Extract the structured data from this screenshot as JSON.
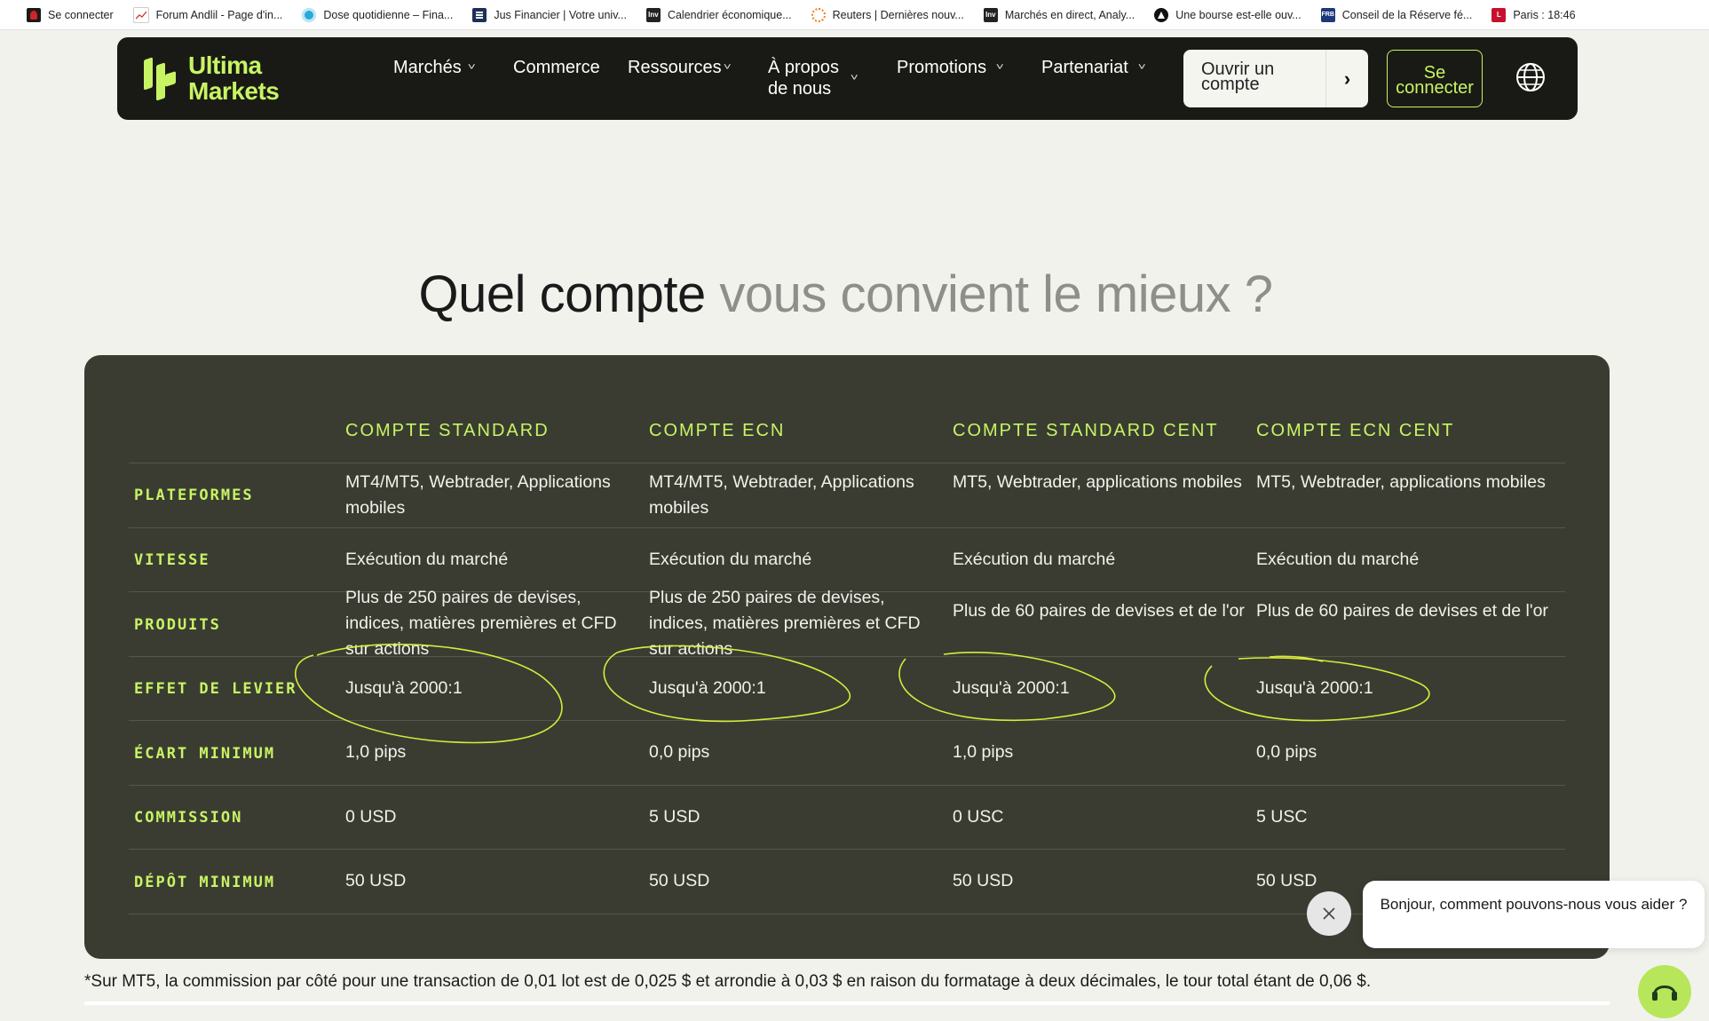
{
  "bookmarks": [
    {
      "icon": "red-logo-icon",
      "label": "Se connecter"
    },
    {
      "icon": "chart-icon",
      "label": "Forum Andlil - Page d'in..."
    },
    {
      "icon": "circle-icon",
      "label": "Dose quotidienne – Fina..."
    },
    {
      "icon": "jus-icon",
      "label": "Jus Financier | Votre univ..."
    },
    {
      "icon": "inv-icon",
      "label": "Calendrier économique..."
    },
    {
      "icon": "reuters-icon",
      "label": "Reuters | Dernières nouv..."
    },
    {
      "icon": "inv-icon",
      "label": "Marchés en direct, Analy..."
    },
    {
      "icon": "triangle-icon",
      "label": "Une bourse est-elle ouv..."
    },
    {
      "icon": "frb-icon",
      "label": "Conseil de la Réserve fé..."
    },
    {
      "icon": "paris-icon",
      "label": "Paris : 18:46"
    }
  ],
  "bookmark_badges": {
    "inv": "Inv",
    "frb": "FRB",
    "paris": "L"
  },
  "header": {
    "logo_line1": "Ultima",
    "logo_line2": "Markets",
    "nav": {
      "marches": "Marchés",
      "commerce": "Commerce",
      "ressources": "Ressources",
      "apropos_line1": "À propos",
      "apropos_line2": "de nous",
      "promotions": "Promotions",
      "partenariat": "Partenariat"
    },
    "open_account": "Ouvrir un compte",
    "login": "Se connecter"
  },
  "heading": {
    "dark": "Quel compte",
    "muted": "vous convient le mieux ?"
  },
  "table": {
    "columns": [
      "COMPTE STANDARD",
      "COMPTE ECN",
      "COMPTE STANDARD CENT",
      "COMPTE ECN CENT"
    ],
    "rows": [
      {
        "label": "PLATEFORMES",
        "values": [
          "MT4/MT5, Webtrader, Applications mobiles",
          "MT4/MT5, Webtrader, Applications mobiles",
          "MT5, Webtrader, applications mobiles",
          "MT5, Webtrader, applications mobiles"
        ]
      },
      {
        "label": "VITESSE",
        "values": [
          "Exécution du marché",
          "Exécution du marché",
          "Exécution du marché",
          "Exécution du marché"
        ]
      },
      {
        "label": "PRODUITS",
        "values": [
          "Plus de 250 paires de devises, indices, matières premières et CFD sur actions",
          "Plus de 250 paires de devises, indices, matières premières et CFD sur actions",
          "Plus de 60 paires de devises et de l'or",
          "Plus de 60 paires de devises et de l'or"
        ]
      },
      {
        "label": "EFFET DE LEVIER",
        "values": [
          "Jusqu'à 2000:1",
          "Jusqu'à 2000:1",
          "Jusqu'à 2000:1",
          "Jusqu'à 2000:1"
        ]
      },
      {
        "label": "ÉCART MINIMUM",
        "values": [
          "1,0 pips",
          "0,0 pips",
          "1,0 pips",
          "0,0 pips"
        ]
      },
      {
        "label": "COMMISSION",
        "values": [
          "0 USD",
          "5 USD",
          "0 USC",
          "5 USC"
        ]
      },
      {
        "label": "DÉPÔT MINIMUM",
        "values": [
          "50 USD",
          "50 USD",
          "50 USD",
          "50 USD"
        ]
      }
    ]
  },
  "footnote": "*Sur MT5, la commission par côté pour une transaction de 0,01 lot est de 0,025 $ et arrondie à 0,03 $ en raison du formatage à deux décimales, le tour total étant de 0,06 $.",
  "chat": {
    "message": "Bonjour, comment pouvons-nous vous aider ?"
  },
  "colors": {
    "accent": "#c8f464",
    "panel": "#3a3c32",
    "navbar": "#191a15",
    "annotation": "#d8ec3a"
  }
}
